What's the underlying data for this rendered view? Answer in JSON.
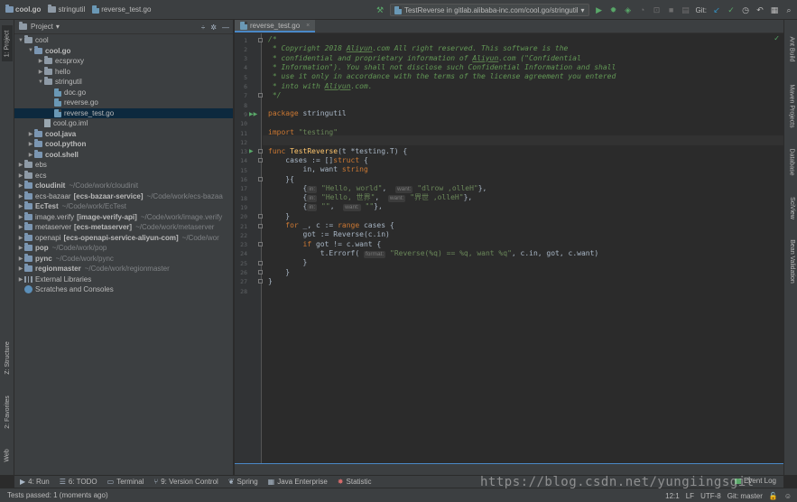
{
  "breadcrumb": [
    "cool.go",
    "stringutil",
    "reverse_test.go"
  ],
  "run_config": "TestReverse in gitlab.alibaba-inc.com/cool.go/stringutil",
  "vcs_label": "Git:",
  "project_panel": {
    "title": "Project",
    "dropdown_icon": "chevron-down-icon"
  },
  "left_stripe": {
    "project": "1: Project",
    "structure": "Z: Structure",
    "favorites": "2: Favorites",
    "web": "Web"
  },
  "right_stripe": [
    "Ant Build",
    "Maven Projects",
    "Database",
    "SciView",
    "Bean Validation"
  ],
  "tree": [
    {
      "depth": 0,
      "arrow": "open",
      "icon": "folder",
      "label": "cool",
      "bold": false,
      "path": ""
    },
    {
      "depth": 1,
      "arrow": "open",
      "icon": "module",
      "label": "cool.go",
      "bold": true,
      "path": ""
    },
    {
      "depth": 2,
      "arrow": "closed",
      "icon": "folder",
      "label": "ecsproxy",
      "bold": false,
      "path": ""
    },
    {
      "depth": 2,
      "arrow": "closed",
      "icon": "folder",
      "label": "hello",
      "bold": false,
      "path": ""
    },
    {
      "depth": 2,
      "arrow": "open",
      "icon": "folder",
      "label": "stringutil",
      "bold": false,
      "path": ""
    },
    {
      "depth": 3,
      "arrow": "none",
      "icon": "go",
      "label": "doc.go",
      "bold": false,
      "path": ""
    },
    {
      "depth": 3,
      "arrow": "none",
      "icon": "go",
      "label": "reverse.go",
      "bold": false,
      "path": ""
    },
    {
      "depth": 3,
      "arrow": "none",
      "icon": "go",
      "label": "reverse_test.go",
      "bold": false,
      "path": "",
      "selected": true
    },
    {
      "depth": 2,
      "arrow": "none",
      "icon": "iml",
      "label": "cool.go.iml",
      "bold": false,
      "path": ""
    },
    {
      "depth": 1,
      "arrow": "closed",
      "icon": "module",
      "label": "cool.java",
      "bold": true,
      "path": ""
    },
    {
      "depth": 1,
      "arrow": "closed",
      "icon": "module",
      "label": "cool.python",
      "bold": true,
      "path": ""
    },
    {
      "depth": 1,
      "arrow": "closed",
      "icon": "module",
      "label": "cool.shell",
      "bold": true,
      "path": ""
    },
    {
      "depth": 0,
      "arrow": "closed",
      "icon": "folder",
      "label": "ebs",
      "bold": false,
      "path": ""
    },
    {
      "depth": 0,
      "arrow": "closed",
      "icon": "folder",
      "label": "ecs",
      "bold": false,
      "path": ""
    },
    {
      "depth": 0,
      "arrow": "closed",
      "icon": "module",
      "label": "cloudinit",
      "bold": true,
      "path": "~/Code/work/cloudinit"
    },
    {
      "depth": 0,
      "arrow": "closed",
      "icon": "module",
      "label": "ecs-bazaar",
      "bold": false,
      "tag": "[ecs-bazaar-service]",
      "path": "~/Code/work/ecs-bazaa"
    },
    {
      "depth": 0,
      "arrow": "closed",
      "icon": "module",
      "label": "EcTest",
      "bold": true,
      "path": "~/Code/work/EcTest"
    },
    {
      "depth": 0,
      "arrow": "closed",
      "icon": "module",
      "label": "image.verify",
      "bold": false,
      "tag": "[image-verify-api]",
      "path": "~/Code/work/image.verify"
    },
    {
      "depth": 0,
      "arrow": "closed",
      "icon": "module",
      "label": "metaserver",
      "bold": false,
      "tag": "[ecs-metaserver]",
      "path": "~/Code/work/metaserver"
    },
    {
      "depth": 0,
      "arrow": "closed",
      "icon": "module",
      "label": "openapi",
      "bold": false,
      "tag": "[ecs-openapi-service-aliyun-com]",
      "path": "~/Code/wor"
    },
    {
      "depth": 0,
      "arrow": "closed",
      "icon": "module",
      "label": "pop",
      "bold": true,
      "path": "~/Code/work/pop"
    },
    {
      "depth": 0,
      "arrow": "closed",
      "icon": "module",
      "label": "pync",
      "bold": true,
      "path": "~/Code/work/pync"
    },
    {
      "depth": 0,
      "arrow": "closed",
      "icon": "module",
      "label": "regionmaster",
      "bold": true,
      "path": "~/Code/work/regionmaster"
    },
    {
      "depth": 0,
      "arrow": "closed",
      "icon": "library",
      "label": "External Libraries",
      "bold": false,
      "path": ""
    },
    {
      "depth": 0,
      "arrow": "none",
      "icon": "scratch",
      "label": "Scratches and Consoles",
      "bold": false,
      "path": ""
    }
  ],
  "editor": {
    "tab_label": "reverse_test.go",
    "lines": [
      [
        [
          "c-com",
          "/*"
        ]
      ],
      [
        [
          "c-com",
          " * Copyright 2018 "
        ],
        [
          "c-com u",
          "Aliyun"
        ],
        [
          "c-com",
          ".com All right reserved. This software is the"
        ]
      ],
      [
        [
          "c-com",
          " * confidential and proprietary information of "
        ],
        [
          "c-com u",
          "Aliyun"
        ],
        [
          "c-com",
          ".com (\"Confidential"
        ]
      ],
      [
        [
          "c-com",
          " * Information\"). You shall not disclose such Confidential Information and shall"
        ]
      ],
      [
        [
          "c-com",
          " * use it only in accordance with the terms of the license agreement you entered"
        ]
      ],
      [
        [
          "c-com",
          " * into with "
        ],
        [
          "c-com u",
          "Aliyun"
        ],
        [
          "c-com",
          ".com."
        ]
      ],
      [
        [
          "c-com",
          " */"
        ]
      ],
      [],
      [
        [
          "c-kw",
          "package "
        ],
        [
          "c-id",
          "stringutil"
        ]
      ],
      [],
      [
        [
          "c-kw",
          "import "
        ],
        [
          "c-str",
          "\"testing\""
        ]
      ],
      [],
      [
        [
          "c-kw",
          "func "
        ],
        [
          "c-fn",
          "TestReverse"
        ],
        [
          "c-id",
          "(t *testing.T) {"
        ]
      ],
      [
        [
          "c-id",
          "    cases := []"
        ],
        [
          "c-kw",
          "struct "
        ],
        [
          "c-id",
          "{"
        ]
      ],
      [
        [
          "c-id",
          "        in, want "
        ],
        [
          "c-kw",
          "string"
        ]
      ],
      [
        [
          "c-id",
          "    }{"
        ]
      ],
      [
        [
          "c-id",
          "        {"
        ],
        [
          "hint",
          "in:"
        ],
        [
          "c-str",
          " \"Hello, world\""
        ],
        [
          "c-id",
          ",  "
        ],
        [
          "hint",
          "want:"
        ],
        [
          "c-str",
          " \"dlrow ,olleH\""
        ],
        [
          "c-id",
          "},"
        ]
      ],
      [
        [
          "c-id",
          "        {"
        ],
        [
          "hint",
          "in:"
        ],
        [
          "c-str",
          " \"Hello, 世界\""
        ],
        [
          "c-id",
          ",  "
        ],
        [
          "hint",
          "want:"
        ],
        [
          "c-str",
          " \"界世 ,olleH\""
        ],
        [
          "c-id",
          "},"
        ]
      ],
      [
        [
          "c-id",
          "        {"
        ],
        [
          "hint",
          "in:"
        ],
        [
          "c-str",
          " \"\""
        ],
        [
          "c-id",
          ",  "
        ],
        [
          "hint",
          "want:"
        ],
        [
          "c-str",
          " \"\""
        ],
        [
          "c-id",
          "},"
        ]
      ],
      [
        [
          "c-id",
          "    }"
        ]
      ],
      [
        [
          "c-kw",
          "    for "
        ],
        [
          "c-id",
          "_, c := "
        ],
        [
          "c-kw",
          "range "
        ],
        [
          "c-id",
          "cases {"
        ]
      ],
      [
        [
          "c-id",
          "        got := Reverse(c.in)"
        ]
      ],
      [
        [
          "c-kw",
          "        if "
        ],
        [
          "c-id",
          "got != c.want {"
        ]
      ],
      [
        [
          "c-id",
          "            t.Errorf( "
        ],
        [
          "hint",
          "format:"
        ],
        [
          "c-str",
          " \"Reverse(%q) == %q, want %q\""
        ],
        [
          "c-id",
          ", c.in, got, c.want)"
        ]
      ],
      [
        [
          "c-id",
          "        }"
        ]
      ],
      [
        [
          "c-id",
          "    }"
        ]
      ],
      [
        [
          "c-id",
          "}"
        ]
      ],
      []
    ]
  },
  "bottom_tools": [
    {
      "icon": "run-icon",
      "label": "4: Run"
    },
    {
      "icon": "todo-icon",
      "label": "6: TODO"
    },
    {
      "icon": "terminal-icon",
      "label": "Terminal"
    },
    {
      "icon": "vcs-icon",
      "label": "9: Version Control"
    },
    {
      "icon": "spring-icon",
      "label": "Spring"
    },
    {
      "icon": "java-enterprise-icon",
      "label": "Java Enterprise"
    },
    {
      "icon": "statistic-icon",
      "label": "Statistic"
    }
  ],
  "event_log": "Event Log",
  "status": {
    "message": "Tests passed: 1 (moments ago)",
    "position": "12:1",
    "line_sep": "LF",
    "encoding": "UTF-8",
    "branch": "Git: master"
  },
  "watermark": "https://blog.csdn.net/yungiingsgit"
}
